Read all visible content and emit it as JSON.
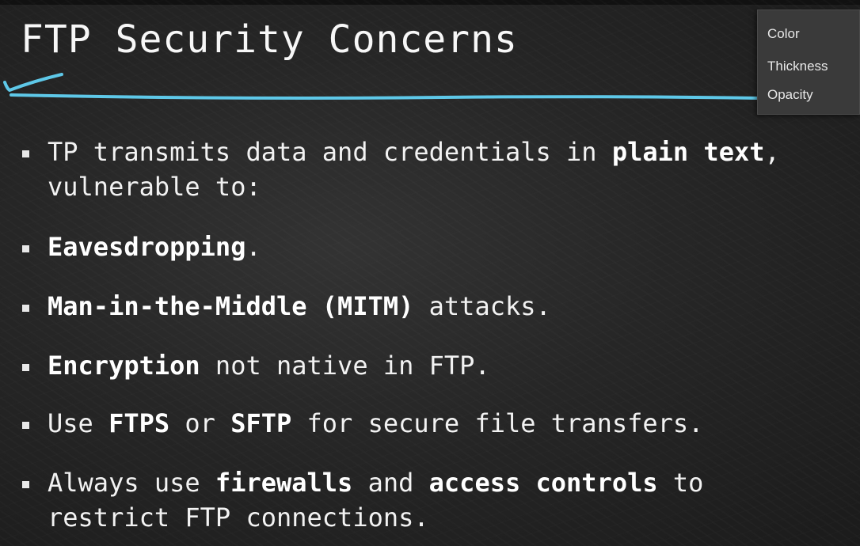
{
  "slide": {
    "title": "FTP Security Concerns",
    "bullets": [
      {
        "parts": [
          "TP transmits data and credentials in ",
          "plain text",
          ","
        ],
        "line2": "vulnerable to:"
      },
      {
        "bold": "Eavesdropping",
        "rest": "."
      },
      {
        "bold": "Man-in-the-Middle (MITM)",
        "rest": " attacks."
      },
      {
        "bold": "Encryption",
        "rest": " not native in FTP."
      },
      {
        "pre": "Use ",
        "bold1": "FTPS",
        "mid": " or ",
        "bold2": "SFTP",
        "post": " for secure file transfers."
      },
      {
        "pre": "Always use ",
        "bold1": "firewalls",
        "mid": " and ",
        "bold2": "access controls",
        "post": " to",
        "line2": "restrict FTP connections."
      }
    ]
  },
  "pen_menu": {
    "items": [
      "Color",
      "Thickness",
      "Opacity"
    ]
  },
  "colors": {
    "background": "#262626",
    "annotation_pen": "#5ec8e8",
    "menu_background": "#3a3a3a"
  }
}
